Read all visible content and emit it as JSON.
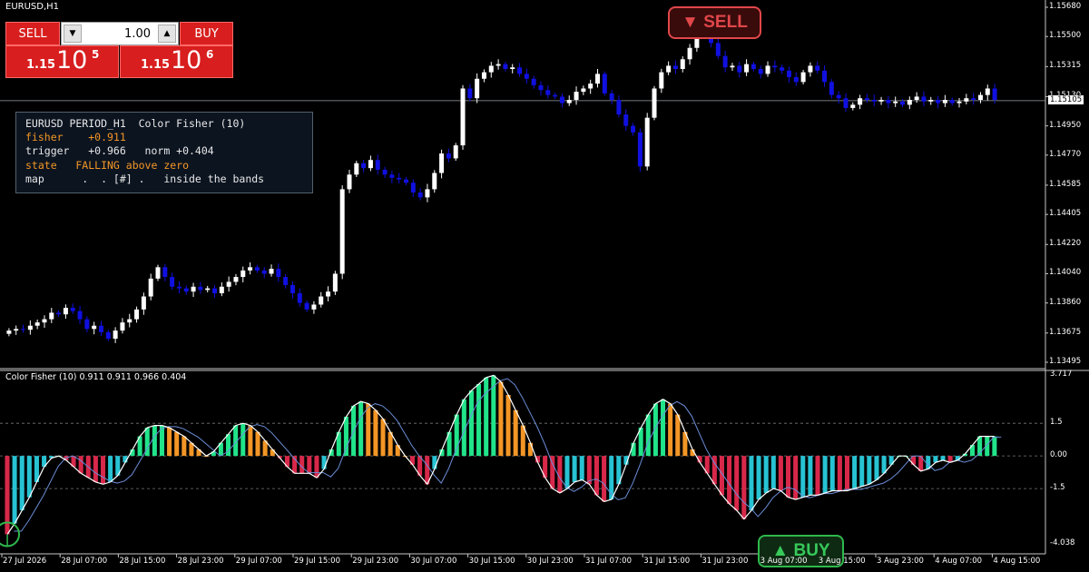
{
  "window": {
    "symbol_title": "EURUSD,H1"
  },
  "trade_panel": {
    "sell_label": "SELL",
    "buy_label": "BUY",
    "lot_value": "1.00",
    "sell_quote": {
      "prefix": "1.15",
      "big": "10",
      "sup": "5"
    },
    "buy_quote": {
      "prefix": "1.15",
      "big": "10",
      "sup": "6"
    },
    "down_icon": "caret-down-icon",
    "up_icon": "caret-up-icon"
  },
  "info_box": {
    "line1": "EURUSD PERIOD_H1  Color Fisher (10)",
    "line2": "fisher    +0.911",
    "line3": "trigger   +0.966   norm +0.404",
    "line4": "state   FALLING above zero",
    "line5": "map      .  . [#] .   inside the bands"
  },
  "signals": {
    "sell": "▼ SELL",
    "buy": "▲ BUY"
  },
  "indicator_title": "Color Fisher (10) 0.911 0.911 0.966 0.404",
  "colors": {
    "bull_candle": "#ffffff",
    "bear_candle": "#1010e0",
    "hist_rising_pos": "#21e48a",
    "hist_falling_pos": "#f39625",
    "hist_falling_neg": "#d8284a",
    "hist_rising_neg": "#27c3d3",
    "fisher_line": "#ffffff",
    "trigger_line": "#6b8ed8"
  },
  "price_axis": {
    "labels": [
      "1.15680",
      "1.15500",
      "1.15315",
      "1.15130",
      "1.14950",
      "1.14770",
      "1.14585",
      "1.14405",
      "1.14220",
      "1.14040",
      "1.13860",
      "1.13675",
      "1.13495"
    ],
    "current": "1.15105"
  },
  "indicator_axis": {
    "labels": [
      "3.717",
      "1.5",
      "0.00",
      "-1.5",
      "-4.038"
    ]
  },
  "time_axis": {
    "labels": [
      "27 Jul 2026",
      "28 Jul 07:00",
      "28 Jul 15:00",
      "28 Jul 23:00",
      "29 Jul 07:00",
      "29 Jul 15:00",
      "29 Jul 23:00",
      "30 Jul 07:00",
      "30 Jul 15:00",
      "30 Jul 23:00",
      "31 Jul 07:00",
      "31 Jul 15:00",
      "31 Jul 23:00",
      "3 Aug 07:00",
      "3 Aug 15:00",
      "3 Aug 23:00",
      "4 Aug 07:00",
      "4 Aug 15:00"
    ]
  },
  "chart_data": {
    "type": "candlestick",
    "price_closes": [
      1.1369,
      1.137,
      1.13695,
      1.1372,
      1.1374,
      1.1376,
      1.138,
      1.1379,
      1.1383,
      1.1381,
      1.1376,
      1.137,
      1.1372,
      1.1368,
      1.1364,
      1.1369,
      1.1374,
      1.1376,
      1.1382,
      1.139,
      1.1401,
      1.1408,
      1.1402,
      1.1396,
      1.1395,
      1.1393,
      1.1396,
      1.1394,
      1.1395,
      1.1392,
      1.1396,
      1.1399,
      1.1402,
      1.1406,
      1.1408,
      1.1406,
      1.1404,
      1.1407,
      1.1402,
      1.1397,
      1.1392,
      1.1386,
      1.1382,
      1.1385,
      1.139,
      1.1393,
      1.1404,
      1.1456,
      1.1465,
      1.1472,
      1.1469,
      1.1474,
      1.1468,
      1.1465,
      1.1463,
      1.1462,
      1.146,
      1.1454,
      1.1451,
      1.1456,
      1.1466,
      1.1478,
      1.1475,
      1.1483,
      1.1518,
      1.1512,
      1.1524,
      1.1528,
      1.1532,
      1.1533,
      1.153,
      1.1531,
      1.1527,
      1.1524,
      1.152,
      1.1517,
      1.1514,
      1.1513,
      1.1509,
      1.1511,
      1.1516,
      1.1518,
      1.1521,
      1.1527,
      1.1515,
      1.1511,
      1.1502,
      1.1495,
      1.1491,
      1.147,
      1.15,
      1.1518,
      1.1528,
      1.1532,
      1.153,
      1.1536,
      1.1543,
      1.1551,
      1.155,
      1.1546,
      1.1538,
      1.1531,
      1.1532,
      1.1528,
      1.1533,
      1.153,
      1.1527,
      1.1532,
      1.1531,
      1.1529,
      1.1525,
      1.1522,
      1.1528,
      1.1532,
      1.1529,
      1.1522,
      1.1514,
      1.1512,
      1.1506,
      1.1508,
      1.1512,
      1.1511,
      1.151,
      1.1511,
      1.1509,
      1.151,
      1.1508,
      1.1511,
      1.1513,
      1.151,
      1.1511,
      1.1509,
      1.1511,
      1.1509,
      1.151,
      1.1512,
      1.1511,
      1.1514,
      1.1518,
      1.1511
    ],
    "indicator": {
      "fisher": 0.911,
      "trigger": 0.966,
      "norm": 0.404,
      "levels": [
        1.5,
        0.0,
        -1.5
      ],
      "range": [
        -4.038,
        3.717
      ],
      "histogram": [
        -3.6,
        -3.1,
        -2.5,
        -1.9,
        -1.2,
        -0.5,
        -0.1,
        0.0,
        -0.2,
        -0.5,
        -0.8,
        -1.0,
        -1.2,
        -1.3,
        -1.2,
        -0.9,
        -0.3,
        0.3,
        0.9,
        1.3,
        1.4,
        1.4,
        1.3,
        1.1,
        0.9,
        0.6,
        0.3,
        0.0,
        0.2,
        0.6,
        1.0,
        1.4,
        1.5,
        1.4,
        1.1,
        0.7,
        0.3,
        -0.1,
        -0.5,
        -0.8,
        -0.8,
        -0.8,
        -1.0,
        -0.6,
        0.3,
        1.1,
        1.8,
        2.3,
        2.5,
        2.4,
        2.1,
        1.7,
        1.1,
        0.5,
        0.0,
        -0.4,
        -0.9,
        -1.3,
        -0.6,
        0.3,
        1.1,
        1.9,
        2.6,
        3.0,
        3.3,
        3.6,
        3.7,
        3.4,
        2.8,
        2.1,
        1.4,
        0.6,
        -0.3,
        -1.0,
        -1.5,
        -1.7,
        -1.5,
        -1.2,
        -1.1,
        -1.3,
        -1.8,
        -2.1,
        -2.0,
        -1.3,
        -0.4,
        0.6,
        1.3,
        1.9,
        2.4,
        2.6,
        2.4,
        1.9,
        1.1,
        0.3,
        -0.3,
        -0.8,
        -1.3,
        -1.8,
        -2.2,
        -2.5,
        -2.9,
        -2.5,
        -2.0,
        -1.7,
        -1.5,
        -1.6,
        -1.9,
        -2.0,
        -1.9,
        -1.8,
        -1.8,
        -1.7,
        -1.6,
        -1.6,
        -1.6,
        -1.5,
        -1.4,
        -1.3,
        -1.1,
        -0.8,
        -0.4,
        0.0,
        0.0,
        -0.4,
        -0.7,
        -0.6,
        -0.3,
        -0.2,
        -0.3,
        -0.2,
        0.1,
        0.5,
        0.9,
        0.9,
        0.9
      ]
    },
    "signals": [
      {
        "type": "sell",
        "time": "31 Jul 23:00"
      },
      {
        "type": "buy",
        "time": "3 Aug 07:00"
      }
    ]
  }
}
